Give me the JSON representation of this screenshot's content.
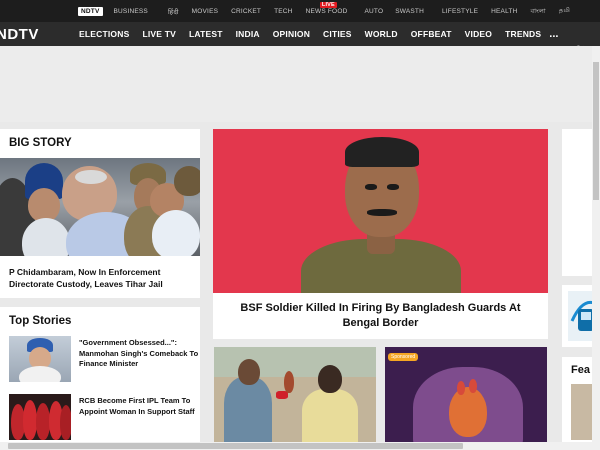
{
  "topbar": {
    "items": [
      {
        "label": "NDTV",
        "active": true
      },
      {
        "label": "BUSINESS"
      },
      {
        "label": "हिंदी"
      },
      {
        "label": "MOVIES"
      },
      {
        "label": "CRICKET"
      },
      {
        "label": "TECH"
      },
      {
        "label": "NEWS"
      },
      {
        "label": "FOOD"
      },
      {
        "label": "AUTO"
      },
      {
        "label": "SWASTH"
      },
      {
        "label": "LIFESTYLE"
      },
      {
        "label": "HEALTH"
      },
      {
        "label": "বাংলা"
      },
      {
        "label": "தமி"
      }
    ],
    "live_badge": "LIVE"
  },
  "navbar": {
    "logo": "NDTV",
    "items": [
      "ELECTIONS",
      "LIVE TV",
      "LATEST",
      "INDIA",
      "OPINION",
      "CITIES",
      "WORLD",
      "OFFBEAT",
      "VIDEO",
      "TRENDS"
    ],
    "more": "...",
    "twitter_icon": "twitter-icon"
  },
  "big_story": {
    "heading": "BIG STORY",
    "caption": "P Chidambaram, Now In Enforcement Directorate Custody, Leaves Tihar Jail"
  },
  "top_stories": {
    "heading": "Top Stories",
    "items": [
      {
        "text": "\"Government Obsessed...\": Manmohan Singh's Comeback To Finance Minister"
      },
      {
        "text": "RCB Become First IPL Team To Appoint Woman In Support Staff"
      }
    ]
  },
  "hero": {
    "caption": "BSF Soldier Killed In Firing By Bangladesh Guards At Bengal Border"
  },
  "thumbs": {
    "badge": "Sponsored"
  },
  "right_column": {
    "feature_heading": "Fea"
  },
  "colors": {
    "topbar_bg": "#1d1d1d",
    "navbar_bg": "#2c2c2c",
    "hero_bg": "#e3374d",
    "live_red": "#e21b22"
  }
}
